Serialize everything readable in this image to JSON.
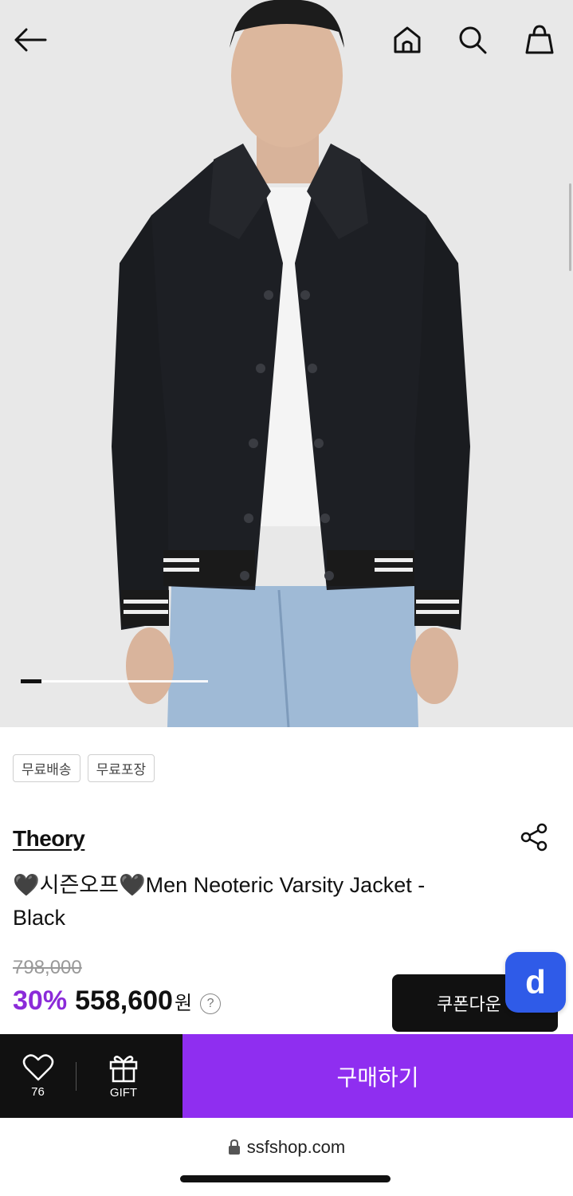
{
  "header": {
    "back_icon": "arrow-left-icon",
    "home_icon": "home-icon",
    "search_icon": "search-icon",
    "cart_icon": "shopping-bag-icon"
  },
  "carousel": {
    "current_index": 1,
    "progress_fraction": 0.11
  },
  "badges": [
    "무료배송",
    "무료포장"
  ],
  "product": {
    "brand": "Theory",
    "title": "🖤시즌오프🖤Men Neoteric Varsity Jacket - Black",
    "original_price": "798,000",
    "discount": "30%",
    "price": "558,600",
    "currency": "원",
    "help_glyph": "?"
  },
  "coupon_button": {
    "label": "쿠폰다운"
  },
  "floating_button": {
    "label": "d",
    "color": "#2f5be8"
  },
  "bottom_bar": {
    "like_count": "76",
    "gift_label": "GIFT",
    "buy_label": "구매하기",
    "buy_color": "#8f2ef0"
  },
  "browser": {
    "url": "ssfshop.com"
  },
  "colors": {
    "accent": "#8b2bd9",
    "dark": "#111111"
  }
}
